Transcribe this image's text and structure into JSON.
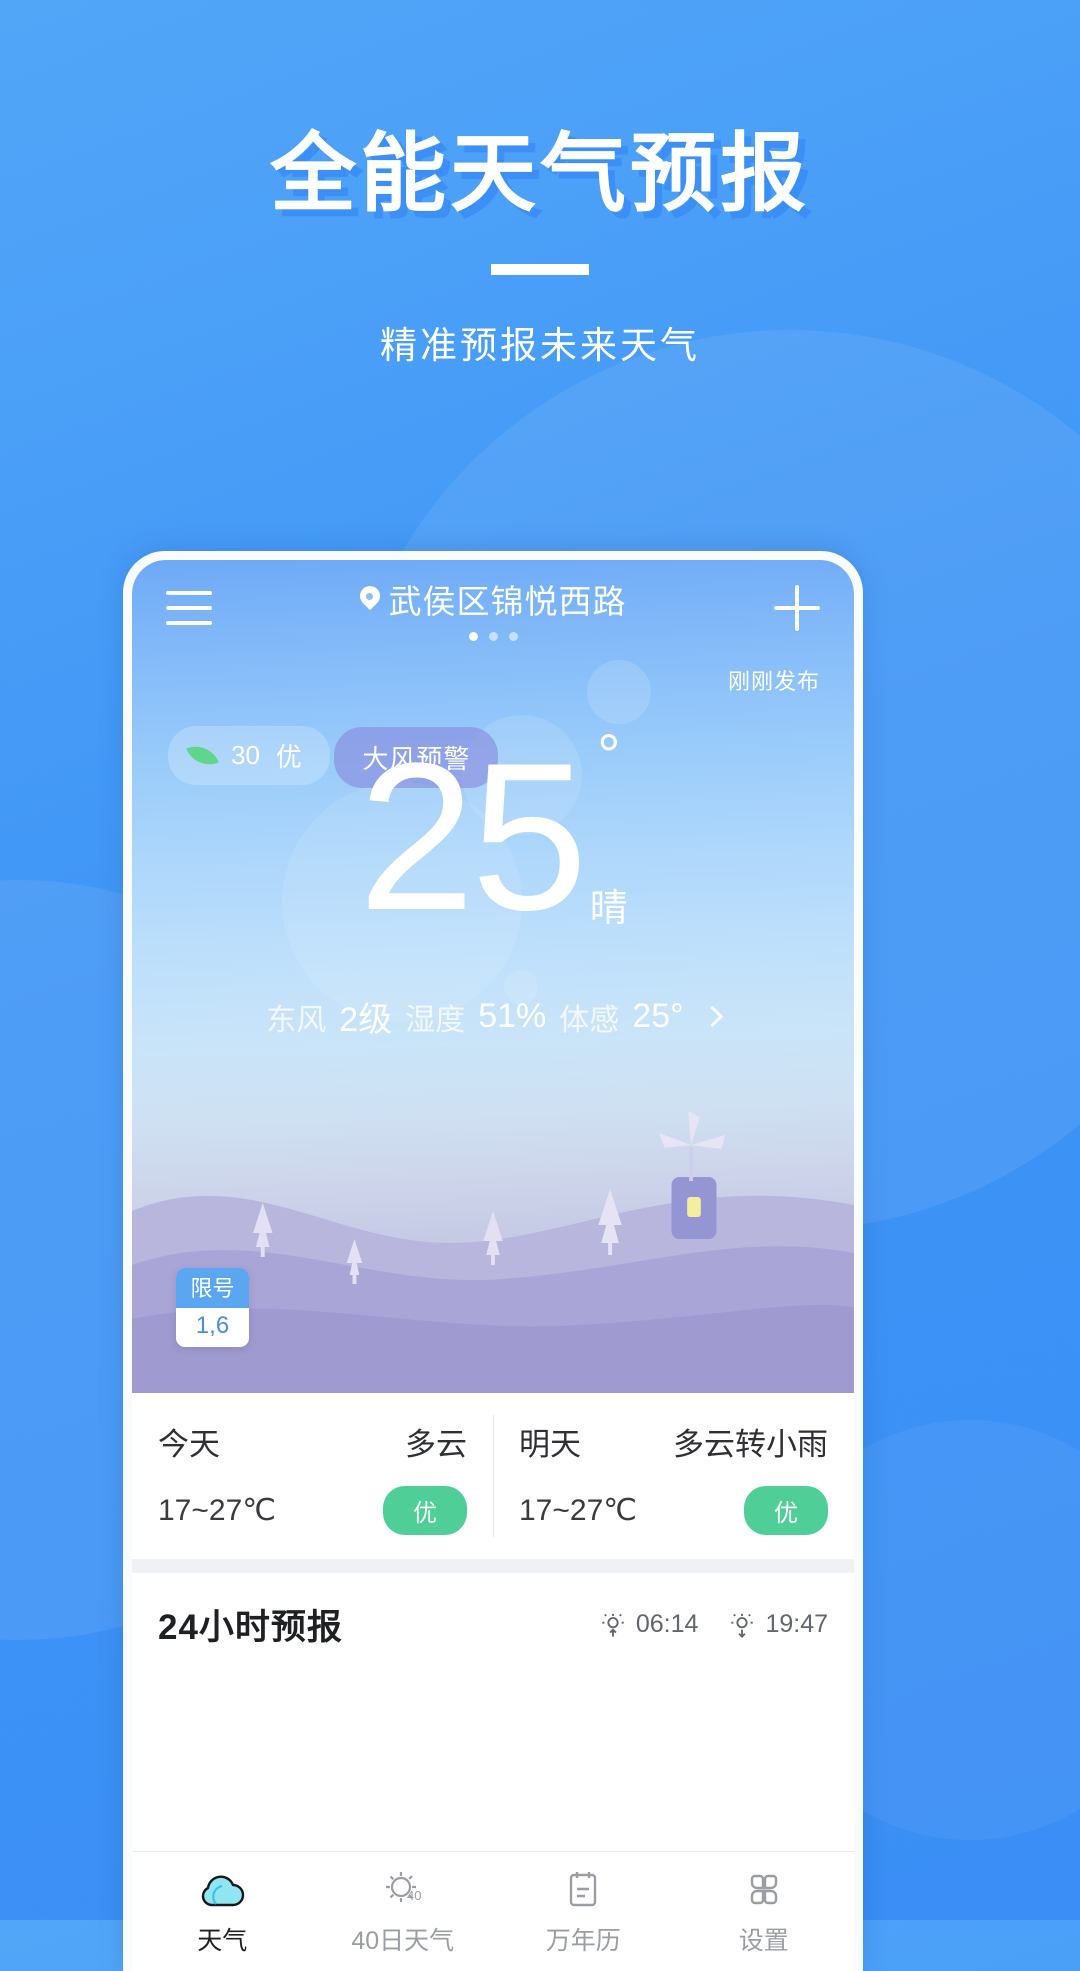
{
  "hero": {
    "title": "全能天气预报",
    "subtitle": "精准预报未来天气"
  },
  "app": {
    "header": {
      "menu_icon": "hamburger-menu-icon",
      "location_pin_icon": "location-pin-icon",
      "location": "武侯区锦悦西路",
      "add_icon": "plus-icon",
      "page_dots": 3
    },
    "publish_time": "刚刚发布",
    "aqi_badge": {
      "icon": "leaf-icon",
      "value": "30",
      "level": "优"
    },
    "alert_badge": {
      "label": "大风预警"
    },
    "current": {
      "temperature": "25",
      "degree": "°",
      "condition": "晴",
      "wind_label": "东风",
      "wind_value": "2级",
      "humidity_label": "湿度",
      "humidity_value": "51%",
      "feels_label": "体感",
      "feels_value": "25°",
      "chevron_icon": "chevron-right-icon"
    },
    "traffic_limit": {
      "title": "限号",
      "value": "1,6"
    },
    "forecast": [
      {
        "day": "今天",
        "condition": "多云",
        "temp_range": "17~27℃",
        "aqi": "优"
      },
      {
        "day": "明天",
        "condition": "多云转小雨",
        "temp_range": "17~27℃",
        "aqi": "优"
      }
    ],
    "hourly_section": {
      "title": "24小时预报",
      "sunrise_icon": "sunrise-icon",
      "sunrise": "06:14",
      "sunset_icon": "sunset-icon",
      "sunset": "19:47"
    },
    "nav": [
      {
        "icon": "cloud-icon",
        "label": "天气",
        "active": true
      },
      {
        "icon": "sun-40-icon",
        "label": "40日天气",
        "active": false
      },
      {
        "icon": "calendar-icon",
        "label": "万年历",
        "active": false
      },
      {
        "icon": "grid-icon",
        "label": "设置",
        "active": false
      }
    ]
  },
  "colors": {
    "brand_blue": "#3f95f6",
    "aqi_green": "#4fcf97",
    "leaf_green": "#5fd68b",
    "alert_purple": "#8787dc",
    "nav_active": "#1f2024",
    "nav_inactive": "#9a9da3"
  }
}
